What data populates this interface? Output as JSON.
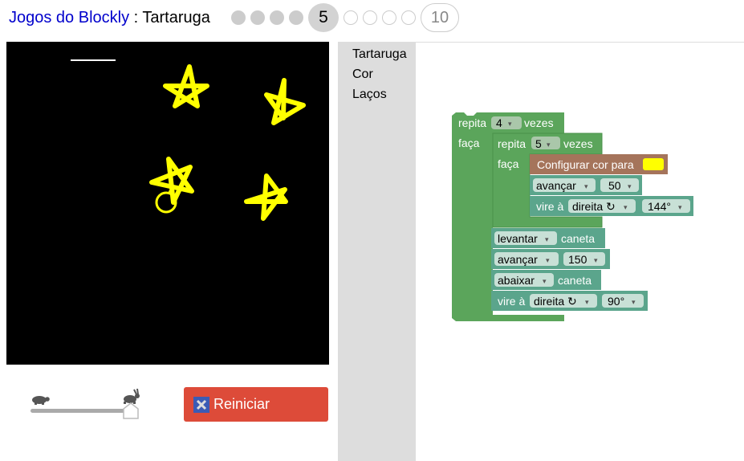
{
  "header": {
    "app_link": "Jogos do Blockly",
    "separator": " : ",
    "game_name": "Tartaruga",
    "current_level": "5",
    "last_level": "10"
  },
  "toolbox": {
    "categories": [
      "Tartaruga",
      "Cor",
      "Laços"
    ]
  },
  "controls": {
    "reset_label": "Reiniciar",
    "speed_fraction": 1.0
  },
  "blocks": {
    "repeat_outer": {
      "label": "repita",
      "count": "4",
      "suffix": "vezes",
      "do": "faça"
    },
    "repeat_inner": {
      "label": "repita",
      "count": "5",
      "suffix": "vezes",
      "do": "faça"
    },
    "set_colour": {
      "label": "Configurar cor para",
      "colour": "#ffff00"
    },
    "move1": {
      "dir": "avançar",
      "value": "50"
    },
    "turn1": {
      "label": "vire à",
      "dir": "direita ↻",
      "value": "144°"
    },
    "pen_up": {
      "action": "levantar",
      "suffix": "caneta"
    },
    "move2": {
      "dir": "avançar",
      "value": "150"
    },
    "pen_down": {
      "action": "abaixar",
      "suffix": "caneta"
    },
    "turn2": {
      "label": "vire à",
      "dir": "direita ↻",
      "value": "90°"
    }
  },
  "colors": {
    "loop_block": "#5ba55b",
    "turtle_block": "#5ba58c",
    "colour_block": "#a5745b",
    "star": "#ffff00",
    "reset": "#dd4b39"
  }
}
